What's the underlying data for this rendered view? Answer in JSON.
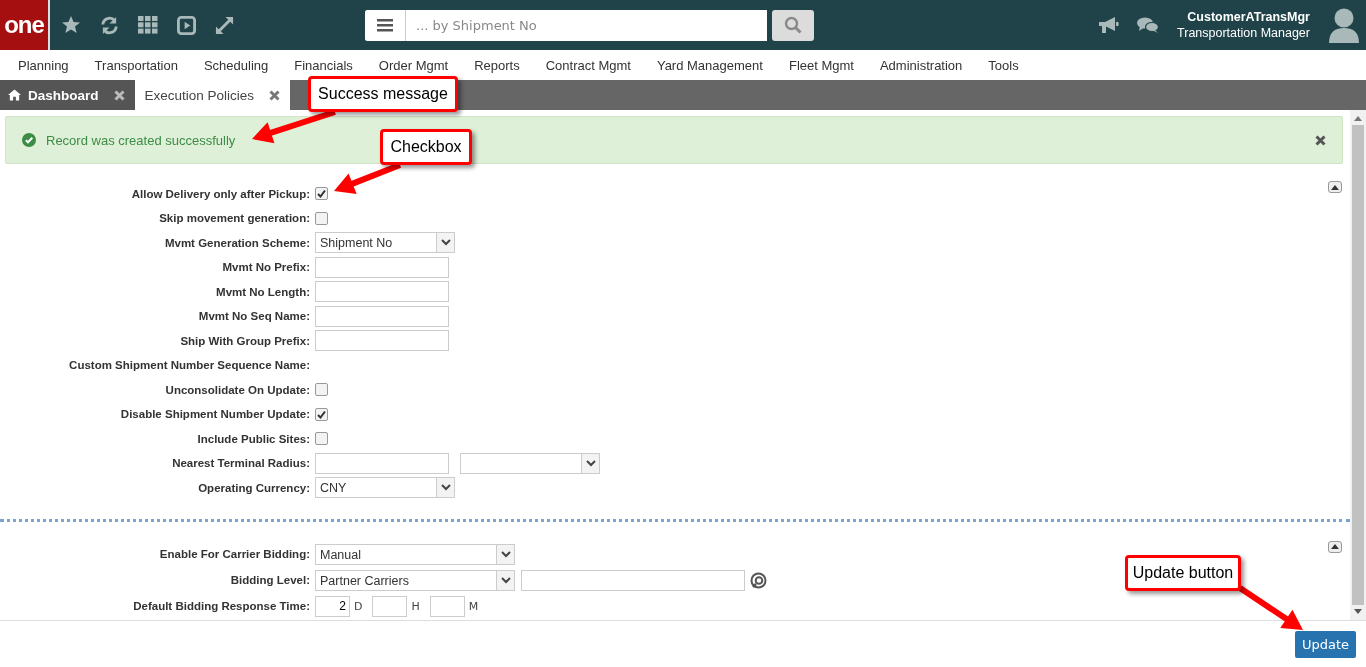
{
  "header": {
    "logo": "one",
    "search": {
      "placeholder": "... by Shipment No"
    },
    "user": {
      "name": "CustomerATransMgr",
      "role": "Transportation Manager"
    }
  },
  "menu": [
    "Planning",
    "Transportation",
    "Scheduling",
    "Financials",
    "Order Mgmt",
    "Reports",
    "Contract Mgmt",
    "Yard Management",
    "Fleet Mgmt",
    "Administration",
    "Tools"
  ],
  "tabs": [
    {
      "label": "Dashboard",
      "selected": false,
      "kind": "home"
    },
    {
      "label": "Execution Policies",
      "selected": true,
      "kind": "page"
    }
  ],
  "alert": {
    "message": "Record was created successfully"
  },
  "sections": [
    {
      "fields": [
        {
          "label": "Allow Delivery only after Pickup:",
          "kind": "checkbox",
          "checked": true
        },
        {
          "label": "Skip movement generation:",
          "kind": "checkbox",
          "checked": false
        },
        {
          "label": "Mvmt Generation Scheme:",
          "kind": "select",
          "value": "Shipment No"
        },
        {
          "label": "Mvmt No Prefix:",
          "kind": "text"
        },
        {
          "label": "Mvmt No Length:",
          "kind": "text"
        },
        {
          "label": "Mvmt No Seq Name:",
          "kind": "text"
        },
        {
          "label": "Ship With Group Prefix:",
          "kind": "text"
        },
        {
          "label": "Custom Shipment Number Sequence Name:",
          "kind": "none"
        },
        {
          "label": "Unconsolidate On Update:",
          "kind": "checkbox",
          "checked": false
        },
        {
          "label": "Disable Shipment Number Update:",
          "kind": "checkbox",
          "checked": true
        },
        {
          "label": "Include Public Sites:",
          "kind": "checkbox",
          "checked": false
        },
        {
          "label": "Nearest Terminal Radius:",
          "kind": "text-select"
        },
        {
          "label": "Operating Currency:",
          "kind": "select",
          "value": "CNY"
        }
      ]
    },
    {
      "fields": [
        {
          "label": "Enable For Carrier Bidding:",
          "kind": "select-wide",
          "value": "Manual"
        },
        {
          "label": "Bidding Level:",
          "kind": "select-lookup",
          "value": "Partner Carriers"
        },
        {
          "label": "Default Bidding Response Time:",
          "kind": "duration",
          "parts": [
            {
              "value": "2",
              "unit": "D"
            },
            {
              "unit": "H"
            },
            {
              "unit": "M"
            }
          ]
        }
      ]
    }
  ],
  "footer": {
    "button": "Update"
  },
  "annotations": [
    {
      "text": "Success message"
    },
    {
      "text": "Checkbox"
    },
    {
      "text": "Update button"
    }
  ]
}
